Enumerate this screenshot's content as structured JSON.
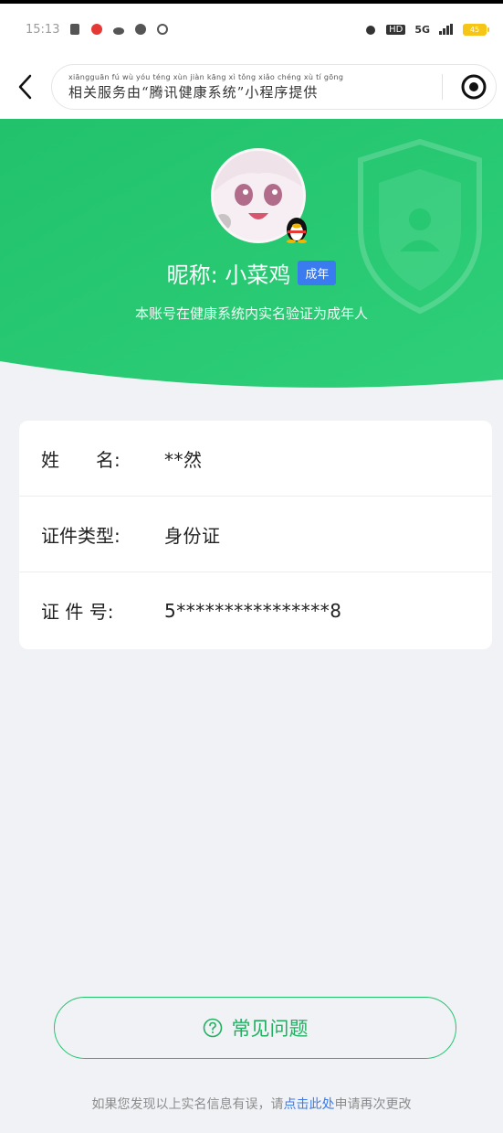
{
  "status_bar": {
    "time": "15:13",
    "network": "5G",
    "hd": "HD",
    "battery": "45"
  },
  "nav": {
    "provider_text": "相关服务由“腾讯健康系统”小程序提供",
    "provider_pinyin": "xiāngguān fú wù yóu téng xùn jiàn kāng xì tǒng xiǎo chéng xù tí gōng"
  },
  "profile": {
    "nickname": "昵称: 小菜鸡",
    "adult_tag": "成年",
    "verify_note": "本账号在健康系统内实名验证为成年人"
  },
  "info": {
    "rows": [
      {
        "label": "姓　　名:",
        "value": "**然"
      },
      {
        "label": "证件类型:",
        "value": "身份证"
      },
      {
        "label": "证 件 号:",
        "value": "5****************8"
      }
    ]
  },
  "faq": {
    "label": "常见问题"
  },
  "footer": {
    "prefix": "如果您发现以上实名信息有误，请",
    "link": "点击此处",
    "suffix": "申请再次更改"
  },
  "colors": {
    "brand_green": "#21c26b",
    "tag_blue": "#3a7bf0",
    "page_bg": "#f0f2f5"
  }
}
